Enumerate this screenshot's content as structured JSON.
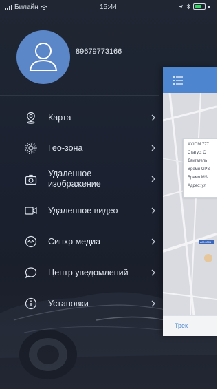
{
  "status_bar": {
    "carrier": "Билайн",
    "time": "15:44"
  },
  "profile": {
    "phone": "89679773166"
  },
  "menu": {
    "items": [
      {
        "label": "Карта",
        "icon": "map-pin-icon"
      },
      {
        "label": "Гео-зона",
        "icon": "geofence-gear-icon"
      },
      {
        "label": "Удаленное изображение",
        "icon": "camera-icon"
      },
      {
        "label": "Удаленное видео",
        "icon": "video-camera-icon"
      },
      {
        "label": "Синхр медиа",
        "icon": "sync-media-icon"
      },
      {
        "label": "Центр уведомлений",
        "icon": "notification-bubble-icon"
      },
      {
        "label": "Установки",
        "icon": "info-icon"
      }
    ]
  },
  "preview": {
    "info_lines": [
      "AXIOM 777",
      "Статус: О",
      "Двигатель",
      "Время GPS",
      "Время MS",
      "Адрес: ул"
    ],
    "map_tag": "AM-0001",
    "bottom_tab": "Трек"
  },
  "colors": {
    "drawer_background": "#1d2330",
    "avatar": "#5b86c7",
    "panel_header": "#4d86cf",
    "accent_text": "#4d86cf",
    "battery": "#35d35f"
  }
}
